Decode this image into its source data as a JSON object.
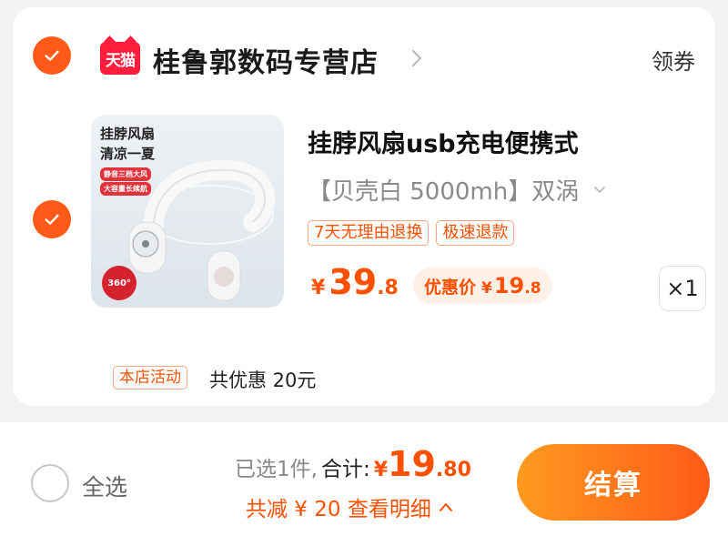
{
  "colors": {
    "accent": "#ff5000",
    "checkout_gradient": [
      "#ff9a1f",
      "#ff5a18"
    ],
    "tmall_red": "#ff1e3c"
  },
  "store": {
    "logo_text": "天猫",
    "name": "桂鲁郭数码专营店",
    "coupon_label": "领券",
    "selected": true
  },
  "item": {
    "selected": true,
    "image": {
      "headline_line1": "挂脖风扇",
      "headline_line2": "清凉一夏",
      "tag1": "静音三档大风",
      "tag2": "大容量长续航",
      "badge": "360°"
    },
    "title": "挂脖风扇usb充电便携式",
    "spec": "【贝壳白 5000mh】双涡",
    "badges": [
      "7天无理由退换",
      "极速退款"
    ],
    "price": {
      "currency": "¥",
      "int": "39",
      "dec": ".8"
    },
    "promo": {
      "label": "优惠价",
      "currency": "¥",
      "int": "19",
      "dec": ".8"
    },
    "quantity": "×1"
  },
  "activity": {
    "tag": "本店活动",
    "text": "共优惠 20元"
  },
  "footer": {
    "select_all_label": "全选",
    "selected_count": "已选1件,",
    "total_label": "合计:",
    "total": {
      "currency": "¥",
      "int": "19",
      "dec": ".80"
    },
    "discount_text": "共减 ¥ 20 查看明细",
    "checkout_label": "结算"
  }
}
